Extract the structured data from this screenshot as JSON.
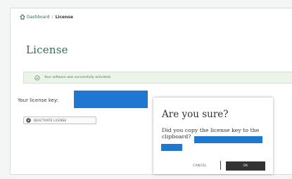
{
  "breadcrumb": {
    "home": "Dashboard",
    "separator": "/",
    "current": "License"
  },
  "page": {
    "title": "License"
  },
  "alert": {
    "message": "Your software was successfully activated."
  },
  "license": {
    "label": "Your license key:"
  },
  "action": {
    "label": "DEACTIVATE LICENSE"
  },
  "modal": {
    "title": "Are you sure?",
    "body": "Did you copy the license key to the clipboard?",
    "cancel_label": "CANCEL",
    "ok_label": "OK"
  },
  "colors": {
    "accent": "#2f6b54",
    "redaction": "#1f77d0",
    "alert_bg": "#ecf4ea",
    "dark_button": "#333333"
  }
}
